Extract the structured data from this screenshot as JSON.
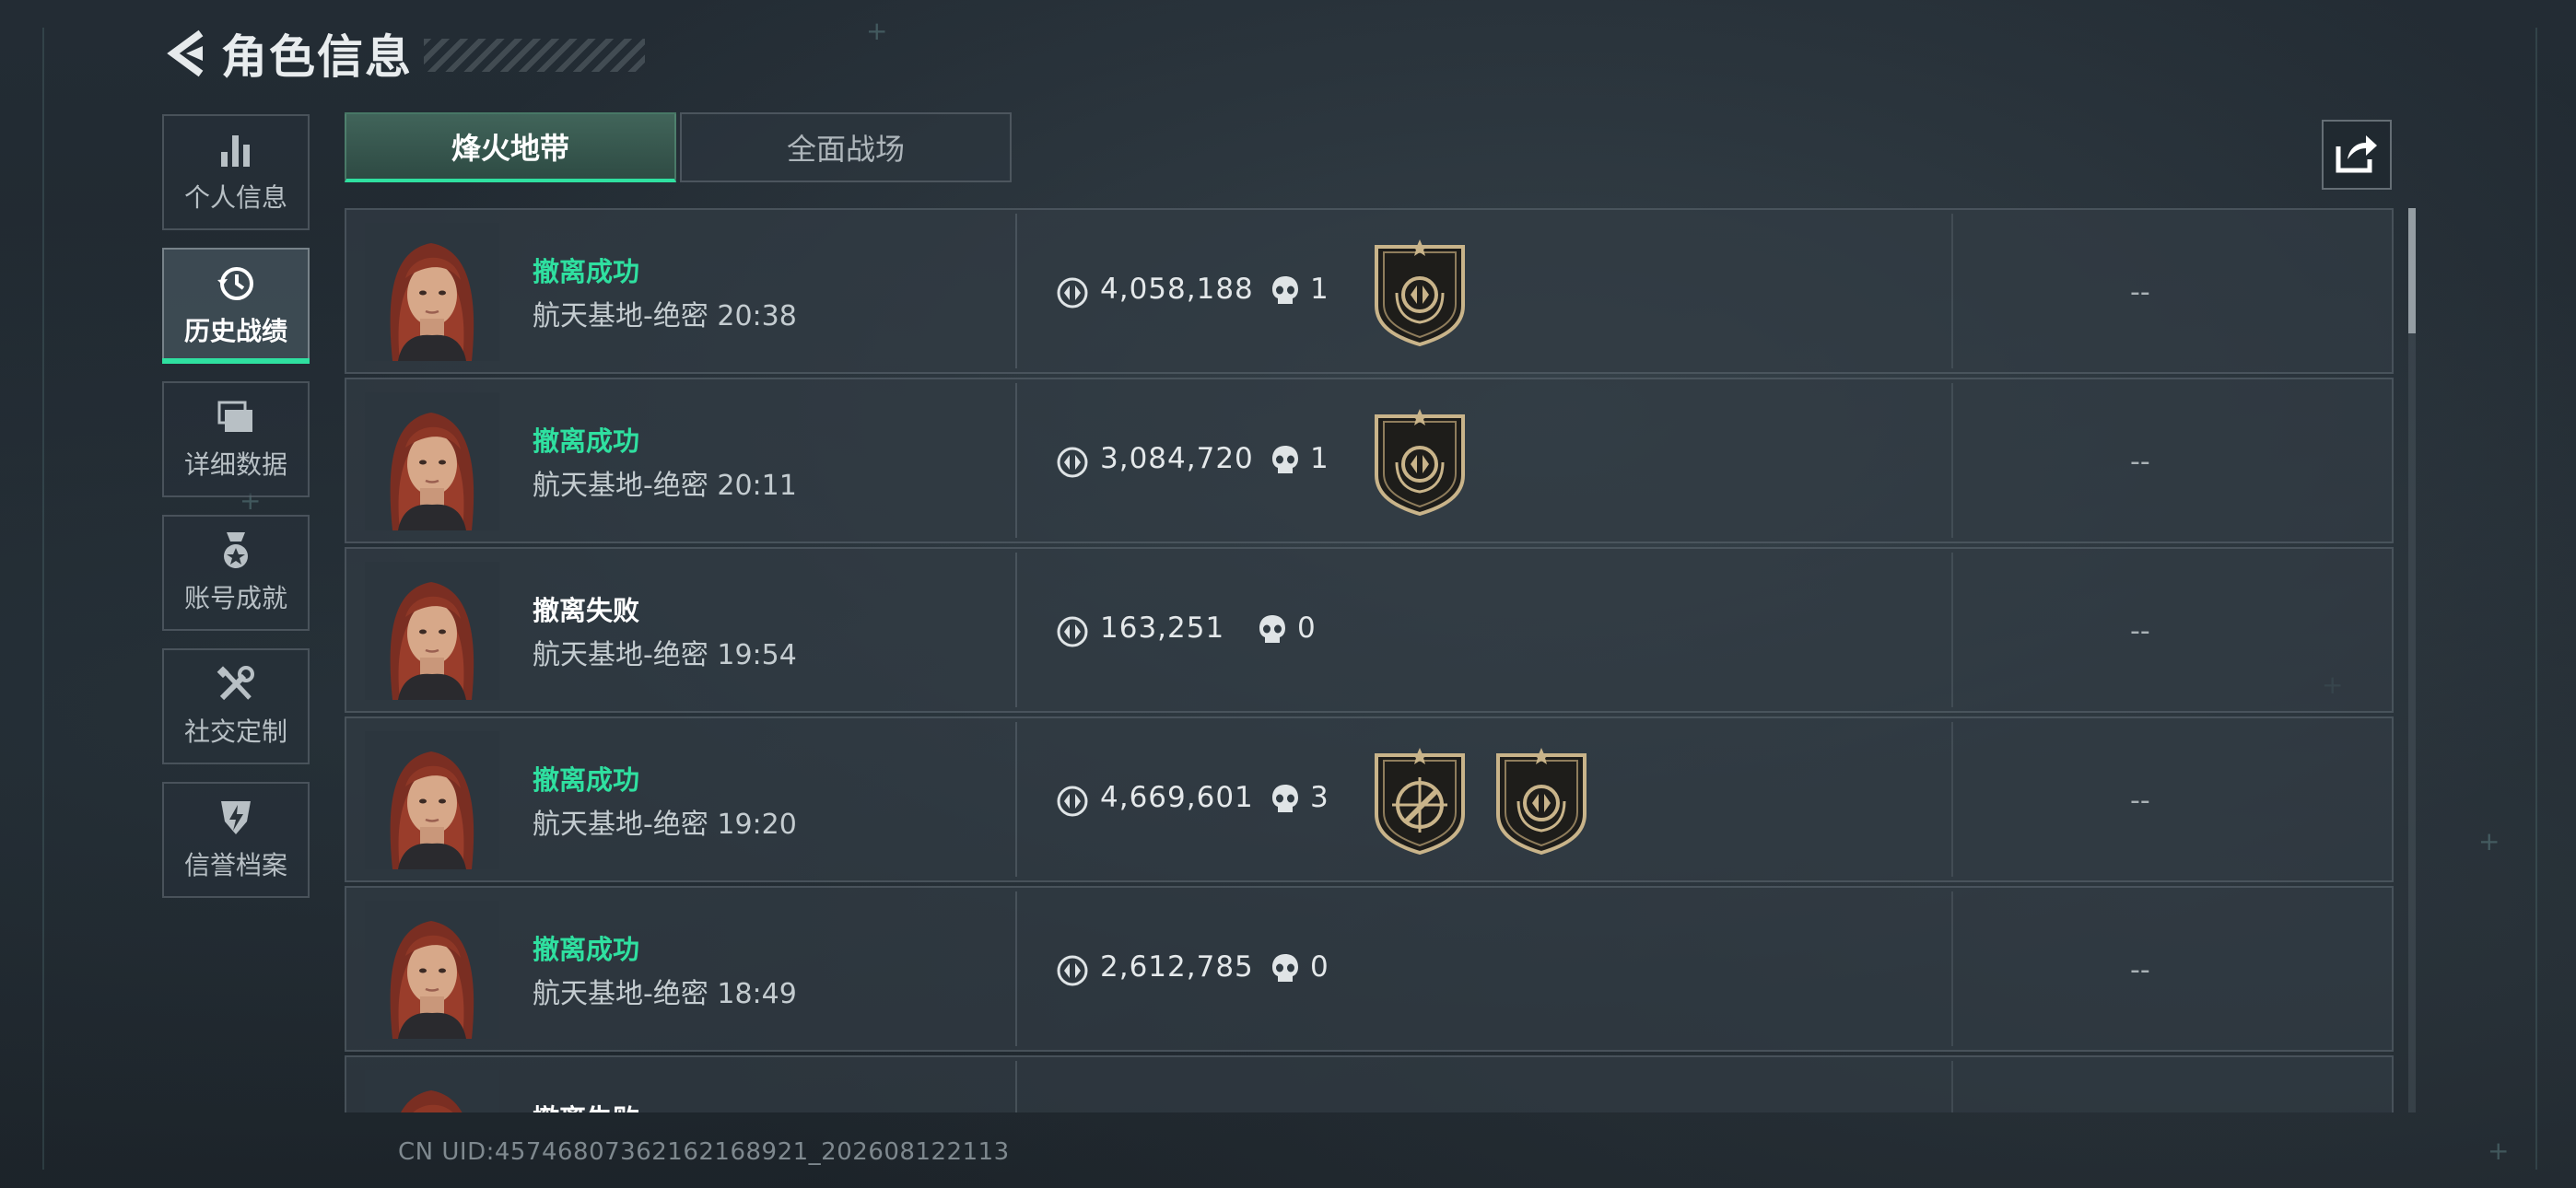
{
  "header": {
    "title": "角色信息",
    "back_icon": "chevron-left-icon"
  },
  "sidebar": {
    "items": [
      {
        "label": "个人信息",
        "icon": "bar-chart-icon",
        "active": false
      },
      {
        "label": "历史战绩",
        "icon": "history-clock-icon",
        "active": true
      },
      {
        "label": "详细数据",
        "icon": "folder-stack-icon",
        "active": false
      },
      {
        "label": "账号成就",
        "icon": "medal-icon",
        "active": false
      },
      {
        "label": "社交定制",
        "icon": "wrench-screwdriver-icon",
        "active": false
      },
      {
        "label": "信誉档案",
        "icon": "shield-bolt-icon",
        "active": false
      }
    ]
  },
  "tabs": [
    {
      "label": "烽火地带",
      "active": true
    },
    {
      "label": "全面战场",
      "active": false
    }
  ],
  "share_icon": "share-export-icon",
  "records": [
    {
      "result": "撤离成功",
      "success": true,
      "map_time": "航天基地-绝密 20:38",
      "value": "4,058,188",
      "kills": "1",
      "badges": [
        "extraction-emblem-badge"
      ],
      "score": "--"
    },
    {
      "result": "撤离成功",
      "success": true,
      "map_time": "航天基地-绝密 20:11",
      "value": "3,084,720",
      "kills": "1",
      "badges": [
        "extraction-emblem-badge"
      ],
      "score": "--"
    },
    {
      "result": "撤离失败",
      "success": false,
      "map_time": "航天基地-绝密 19:54",
      "value": "163,251",
      "kills": "0",
      "badges": [],
      "score": "--"
    },
    {
      "result": "撤离成功",
      "success": true,
      "map_time": "航天基地-绝密 19:20",
      "value": "4,669,601",
      "kills": "3",
      "badges": [
        "crosshair-rifle-badge",
        "extraction-emblem-badge"
      ],
      "score": "--"
    },
    {
      "result": "撤离成功",
      "success": true,
      "map_time": "航天基地-绝密 18:49",
      "value": "2,612,785",
      "kills": "0",
      "badges": [],
      "score": "--"
    },
    {
      "result": "撤离失败",
      "success": false,
      "map_time": "",
      "value": "",
      "kills": "",
      "badges": [],
      "score": ""
    }
  ],
  "footer": {
    "uid": "CN UID:4574680736216216892​1_202608122113"
  },
  "colors": {
    "accent_green": "#2fe0a0",
    "panel": "#323c44",
    "badge_gold": "#c9b48a"
  }
}
